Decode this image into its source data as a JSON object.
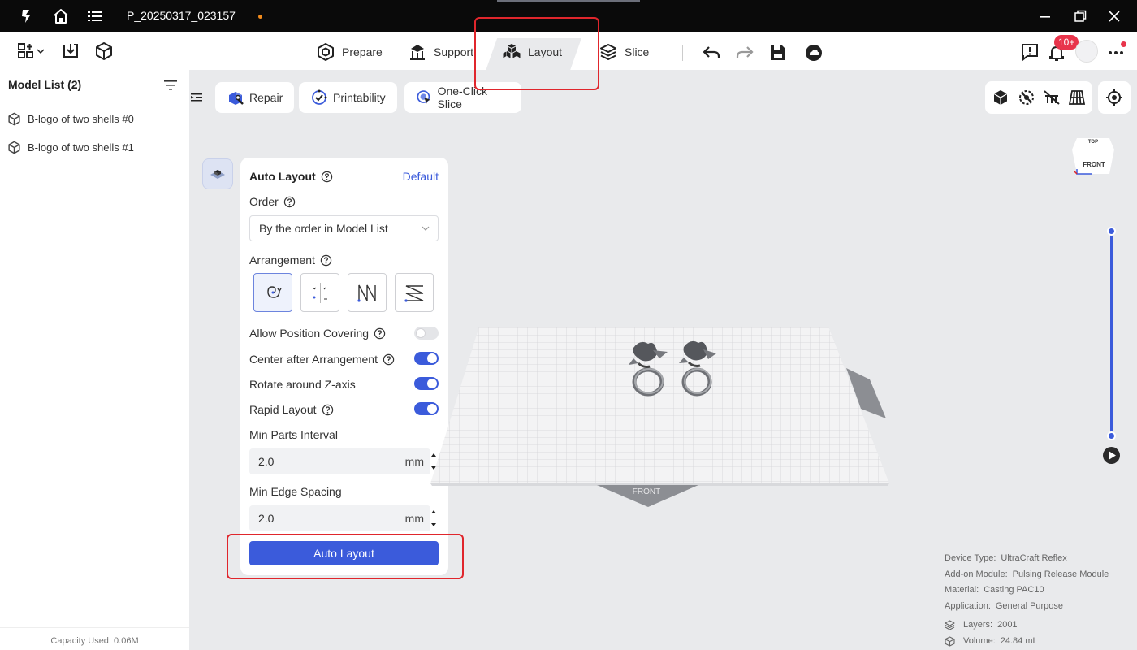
{
  "titlebar": {
    "filename": "P_20250317_023157"
  },
  "tabs": [
    {
      "label": "Prepare"
    },
    {
      "label": "Support"
    },
    {
      "label": "Layout"
    },
    {
      "label": "Slice"
    }
  ],
  "notifications": {
    "badge": "10+"
  },
  "sidebar": {
    "title": "Model List (2)",
    "items": [
      {
        "label": "B-logo of two shells #0"
      },
      {
        "label": "B-logo of two shells #1"
      }
    ],
    "capacity": "Capacity Used: 0.06M"
  },
  "tools": {
    "repair": "Repair",
    "printability": "Printability",
    "one_click_slice": "One-Click Slice"
  },
  "layout_panel": {
    "title": "Auto Layout",
    "default_link": "Default",
    "order_label": "Order",
    "order_value": "By the order in Model List",
    "arrangement_label": "Arrangement",
    "allow_position_covering": {
      "label": "Allow Position Covering",
      "on": false
    },
    "center_after_arrangement": {
      "label": "Center after Arrangement",
      "on": true
    },
    "rotate_z": {
      "label": "Rotate around Z-axis",
      "on": true
    },
    "rapid_layout": {
      "label": "Rapid Layout",
      "on": true
    },
    "min_parts_interval": {
      "label": "Min Parts Interval",
      "value": "2.0",
      "unit": "mm"
    },
    "min_edge_spacing": {
      "label": "Min Edge Spacing",
      "value": "2.0",
      "unit": "mm"
    },
    "button": "Auto Layout"
  },
  "scene": {
    "front_label": "FRONT",
    "cube_top": "TOP",
    "cube_front": "FRONT"
  },
  "layer_slider": {
    "top_fraction": 1.0,
    "bottom_fraction": 0.0
  },
  "info": {
    "device_type": {
      "label": "Device Type:",
      "value": "UltraCraft Reflex"
    },
    "addon": {
      "label": "Add-on Module:",
      "value": "Pulsing Release Module"
    },
    "material": {
      "label": "Material:",
      "value": "Casting PAC10"
    },
    "application": {
      "label": "Application:",
      "value": "General Purpose"
    },
    "layers": {
      "label": "Layers:",
      "value": "2001"
    },
    "volume": {
      "label": "Volume:",
      "value": "24.84 mL"
    }
  },
  "colors": {
    "accent": "#3b5bdb",
    "highlight": "#e0262c",
    "badge": "#e8344b"
  }
}
